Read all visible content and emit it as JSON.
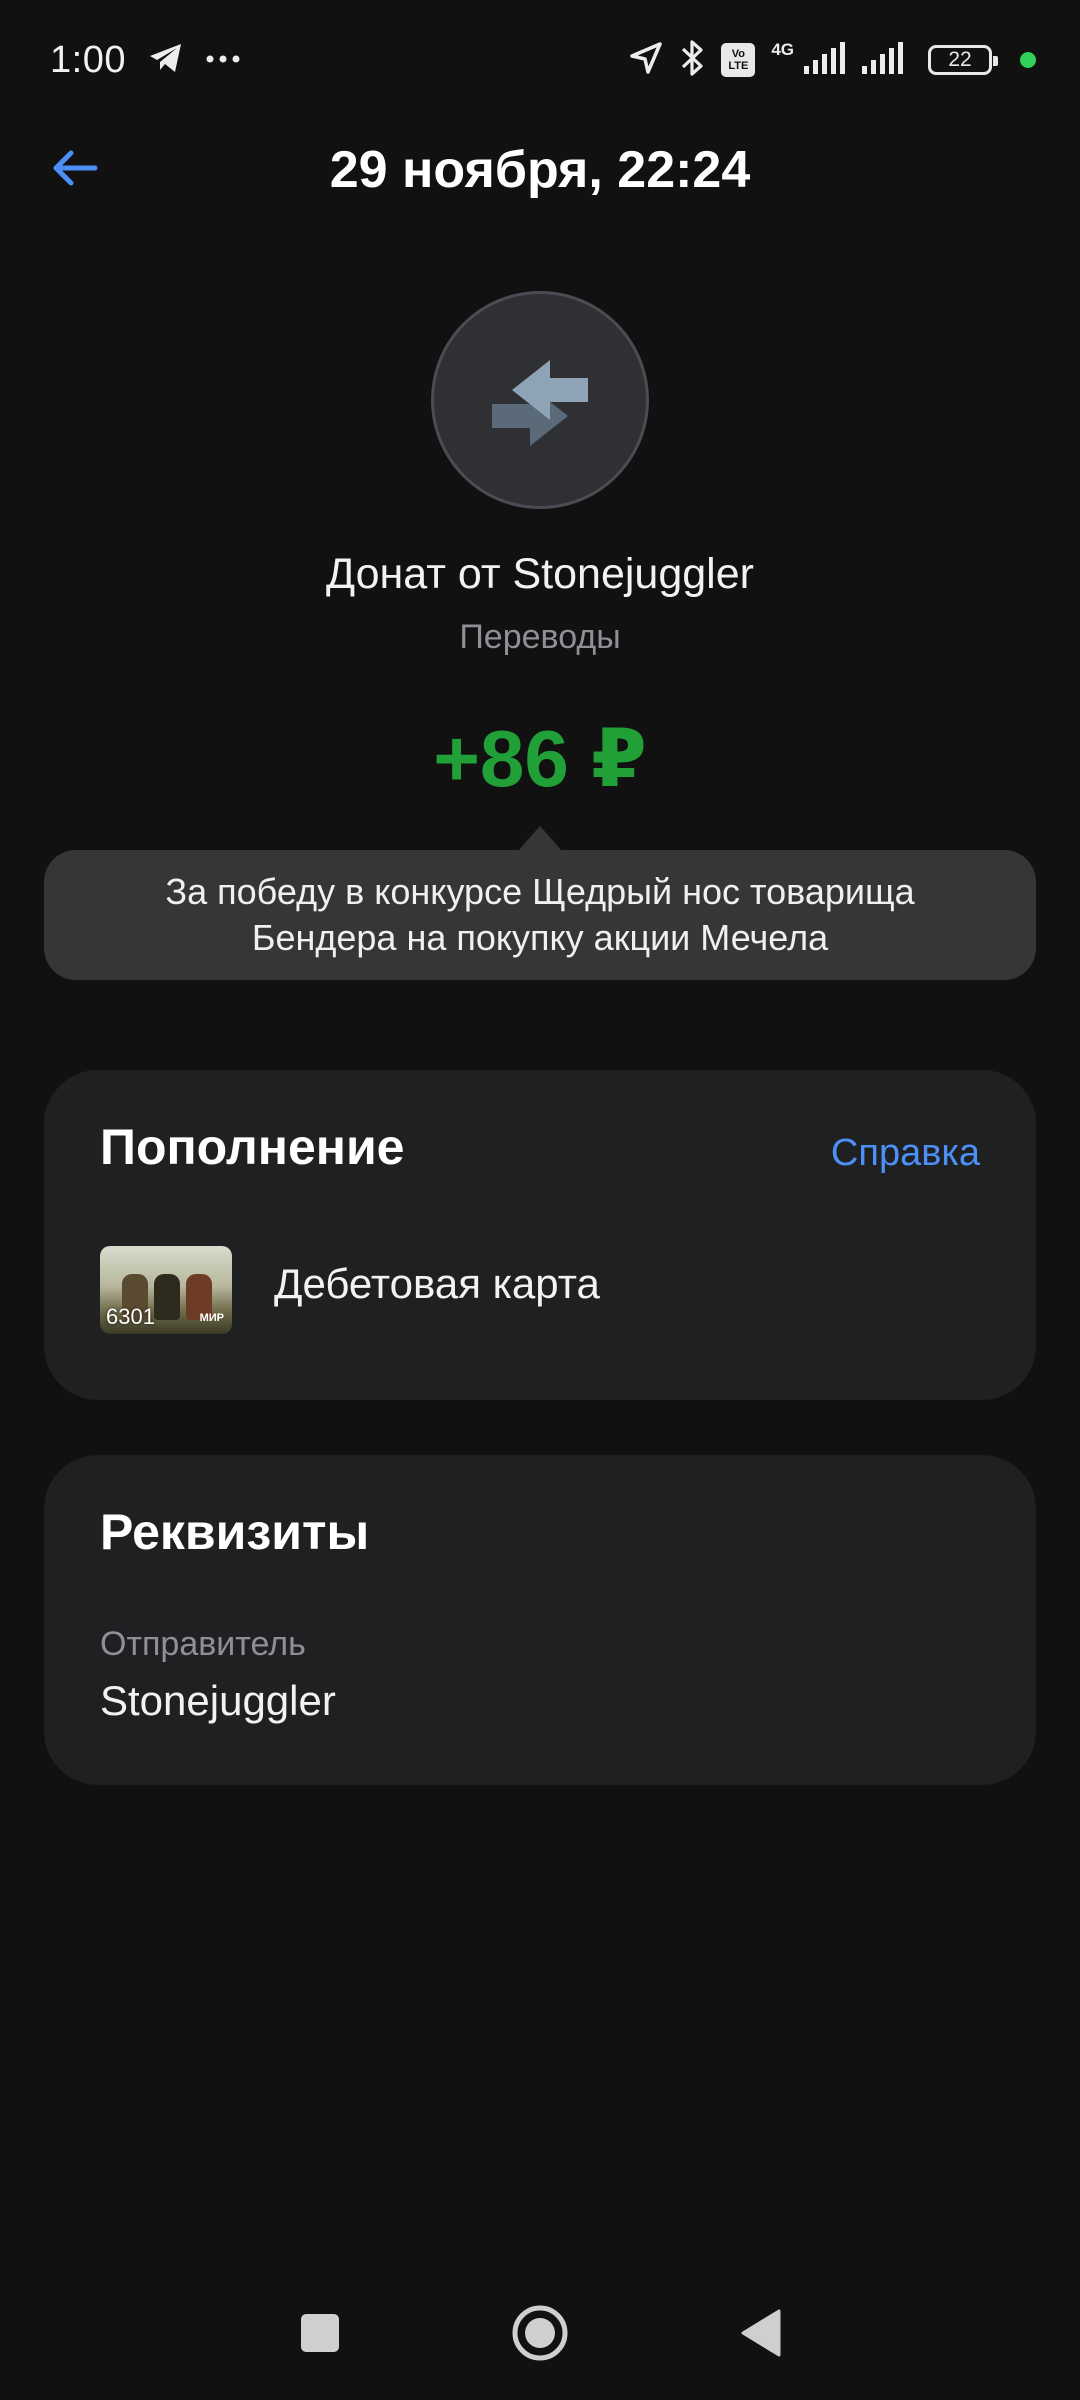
{
  "status_bar": {
    "time": "1:00",
    "volte_line1": "Vo",
    "volte_line2": "LTE",
    "network": "4G",
    "battery": "22",
    "icons": [
      "telegram-icon",
      "more-dots-icon",
      "location-arrow-icon",
      "bluetooth-icon",
      "volte-icon",
      "signal-icon",
      "signal-icon",
      "battery-icon"
    ]
  },
  "header": {
    "title": "29 ноября, 22:24",
    "back_icon": "arrow-left-icon"
  },
  "transaction": {
    "icon": "transfer-arrows-icon",
    "name": "Донат от Stonejuggler",
    "category": "Переводы",
    "amount": "+86 ₽",
    "comment": "За победу в конкурсе Щедрый нос товарища Бендера на покупку акции Мечела"
  },
  "topup_card": {
    "title": "Пополнение",
    "help_link": "Справка",
    "card_number": "6301",
    "card_brand": "МИР",
    "card_name": "Дебетовая карта"
  },
  "requisites_card": {
    "title": "Реквизиты",
    "sender_label": "Отправитель",
    "sender_value": "Stonejuggler"
  },
  "nav_bar": {
    "buttons": [
      "recents-square-icon",
      "home-circle-icon",
      "back-triangle-icon"
    ]
  },
  "colors": {
    "background": "#111112",
    "card": "#1f2022",
    "accent_blue": "#4c8ff5",
    "amount_green": "#21a038",
    "secondary_text": "#8e9096"
  }
}
